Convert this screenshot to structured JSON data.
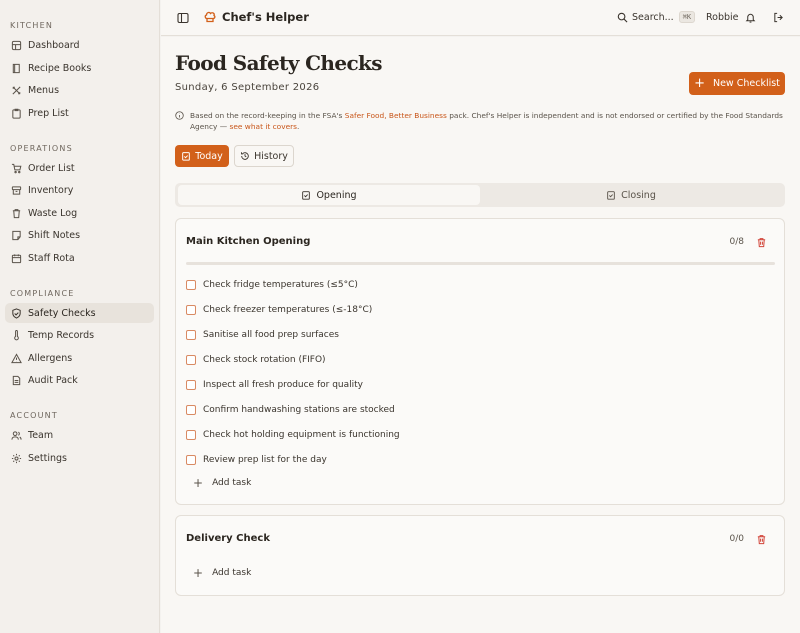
{
  "sidebar": {
    "sections": [
      {
        "title": "KITCHEN",
        "items": [
          {
            "label": "Dashboard",
            "icon": "dashboard-icon"
          },
          {
            "label": "Recipe Books",
            "icon": "book-icon"
          },
          {
            "label": "Menus",
            "icon": "utensils-icon"
          },
          {
            "label": "Prep List",
            "icon": "clipboard-icon"
          }
        ]
      },
      {
        "title": "OPERATIONS",
        "items": [
          {
            "label": "Order List",
            "icon": "cart-icon"
          },
          {
            "label": "Inventory",
            "icon": "archive-icon"
          },
          {
            "label": "Waste Log",
            "icon": "trash-icon"
          },
          {
            "label": "Shift Notes",
            "icon": "note-icon"
          },
          {
            "label": "Staff Rota",
            "icon": "calendar-icon"
          }
        ]
      },
      {
        "title": "COMPLIANCE",
        "items": [
          {
            "label": "Safety Checks",
            "icon": "shield-check-icon",
            "active": true
          },
          {
            "label": "Temp Records",
            "icon": "thermometer-icon"
          },
          {
            "label": "Allergens",
            "icon": "warning-icon"
          },
          {
            "label": "Audit Pack",
            "icon": "document-icon"
          }
        ]
      },
      {
        "title": "ACCOUNT",
        "items": [
          {
            "label": "Team",
            "icon": "users-icon"
          },
          {
            "label": "Settings",
            "icon": "gear-icon"
          }
        ]
      }
    ]
  },
  "header": {
    "app_name": "Chef's Helper",
    "search_label": "Search...",
    "search_shortcut": "⌘K",
    "user_name": "Robbie"
  },
  "page": {
    "title": "Food Safety Checks",
    "date": "Sunday, 6 September 2026",
    "new_checklist_label": "New Checklist",
    "notice": {
      "prefix": "Based on the record-keeping in the FSA's",
      "link1": "Safer Food, Better Business",
      "middle": "pack. Chef's Helper is independent and is not endorsed or certified by the Food Standards Agency —",
      "link2": "see what it covers",
      "suffix": "."
    },
    "today_label": "Today",
    "history_label": "History",
    "tabs": [
      "Opening",
      "Closing"
    ],
    "selected_tab": "Opening"
  },
  "checklists": [
    {
      "title": "Main Kitchen Opening",
      "count": "0/8",
      "progress": 0,
      "tasks": [
        "Check fridge temperatures (≤5°C)",
        "Check freezer temperatures (≤-18°C)",
        "Sanitise all food prep surfaces",
        "Check stock rotation (FIFO)",
        "Inspect all fresh produce for quality",
        "Confirm handwashing stations are stocked",
        "Check hot holding equipment is functioning",
        "Review prep list for the day"
      ],
      "add_label": "Add task"
    },
    {
      "title": "Delivery Check",
      "count": "0/0",
      "progress": 0,
      "tasks": [],
      "add_label": "Add task"
    }
  ],
  "colors": {
    "accent": "#d2601a",
    "link": "#c8561a",
    "background": "#f9f7f4",
    "sidebar": "#f3f0ec"
  }
}
